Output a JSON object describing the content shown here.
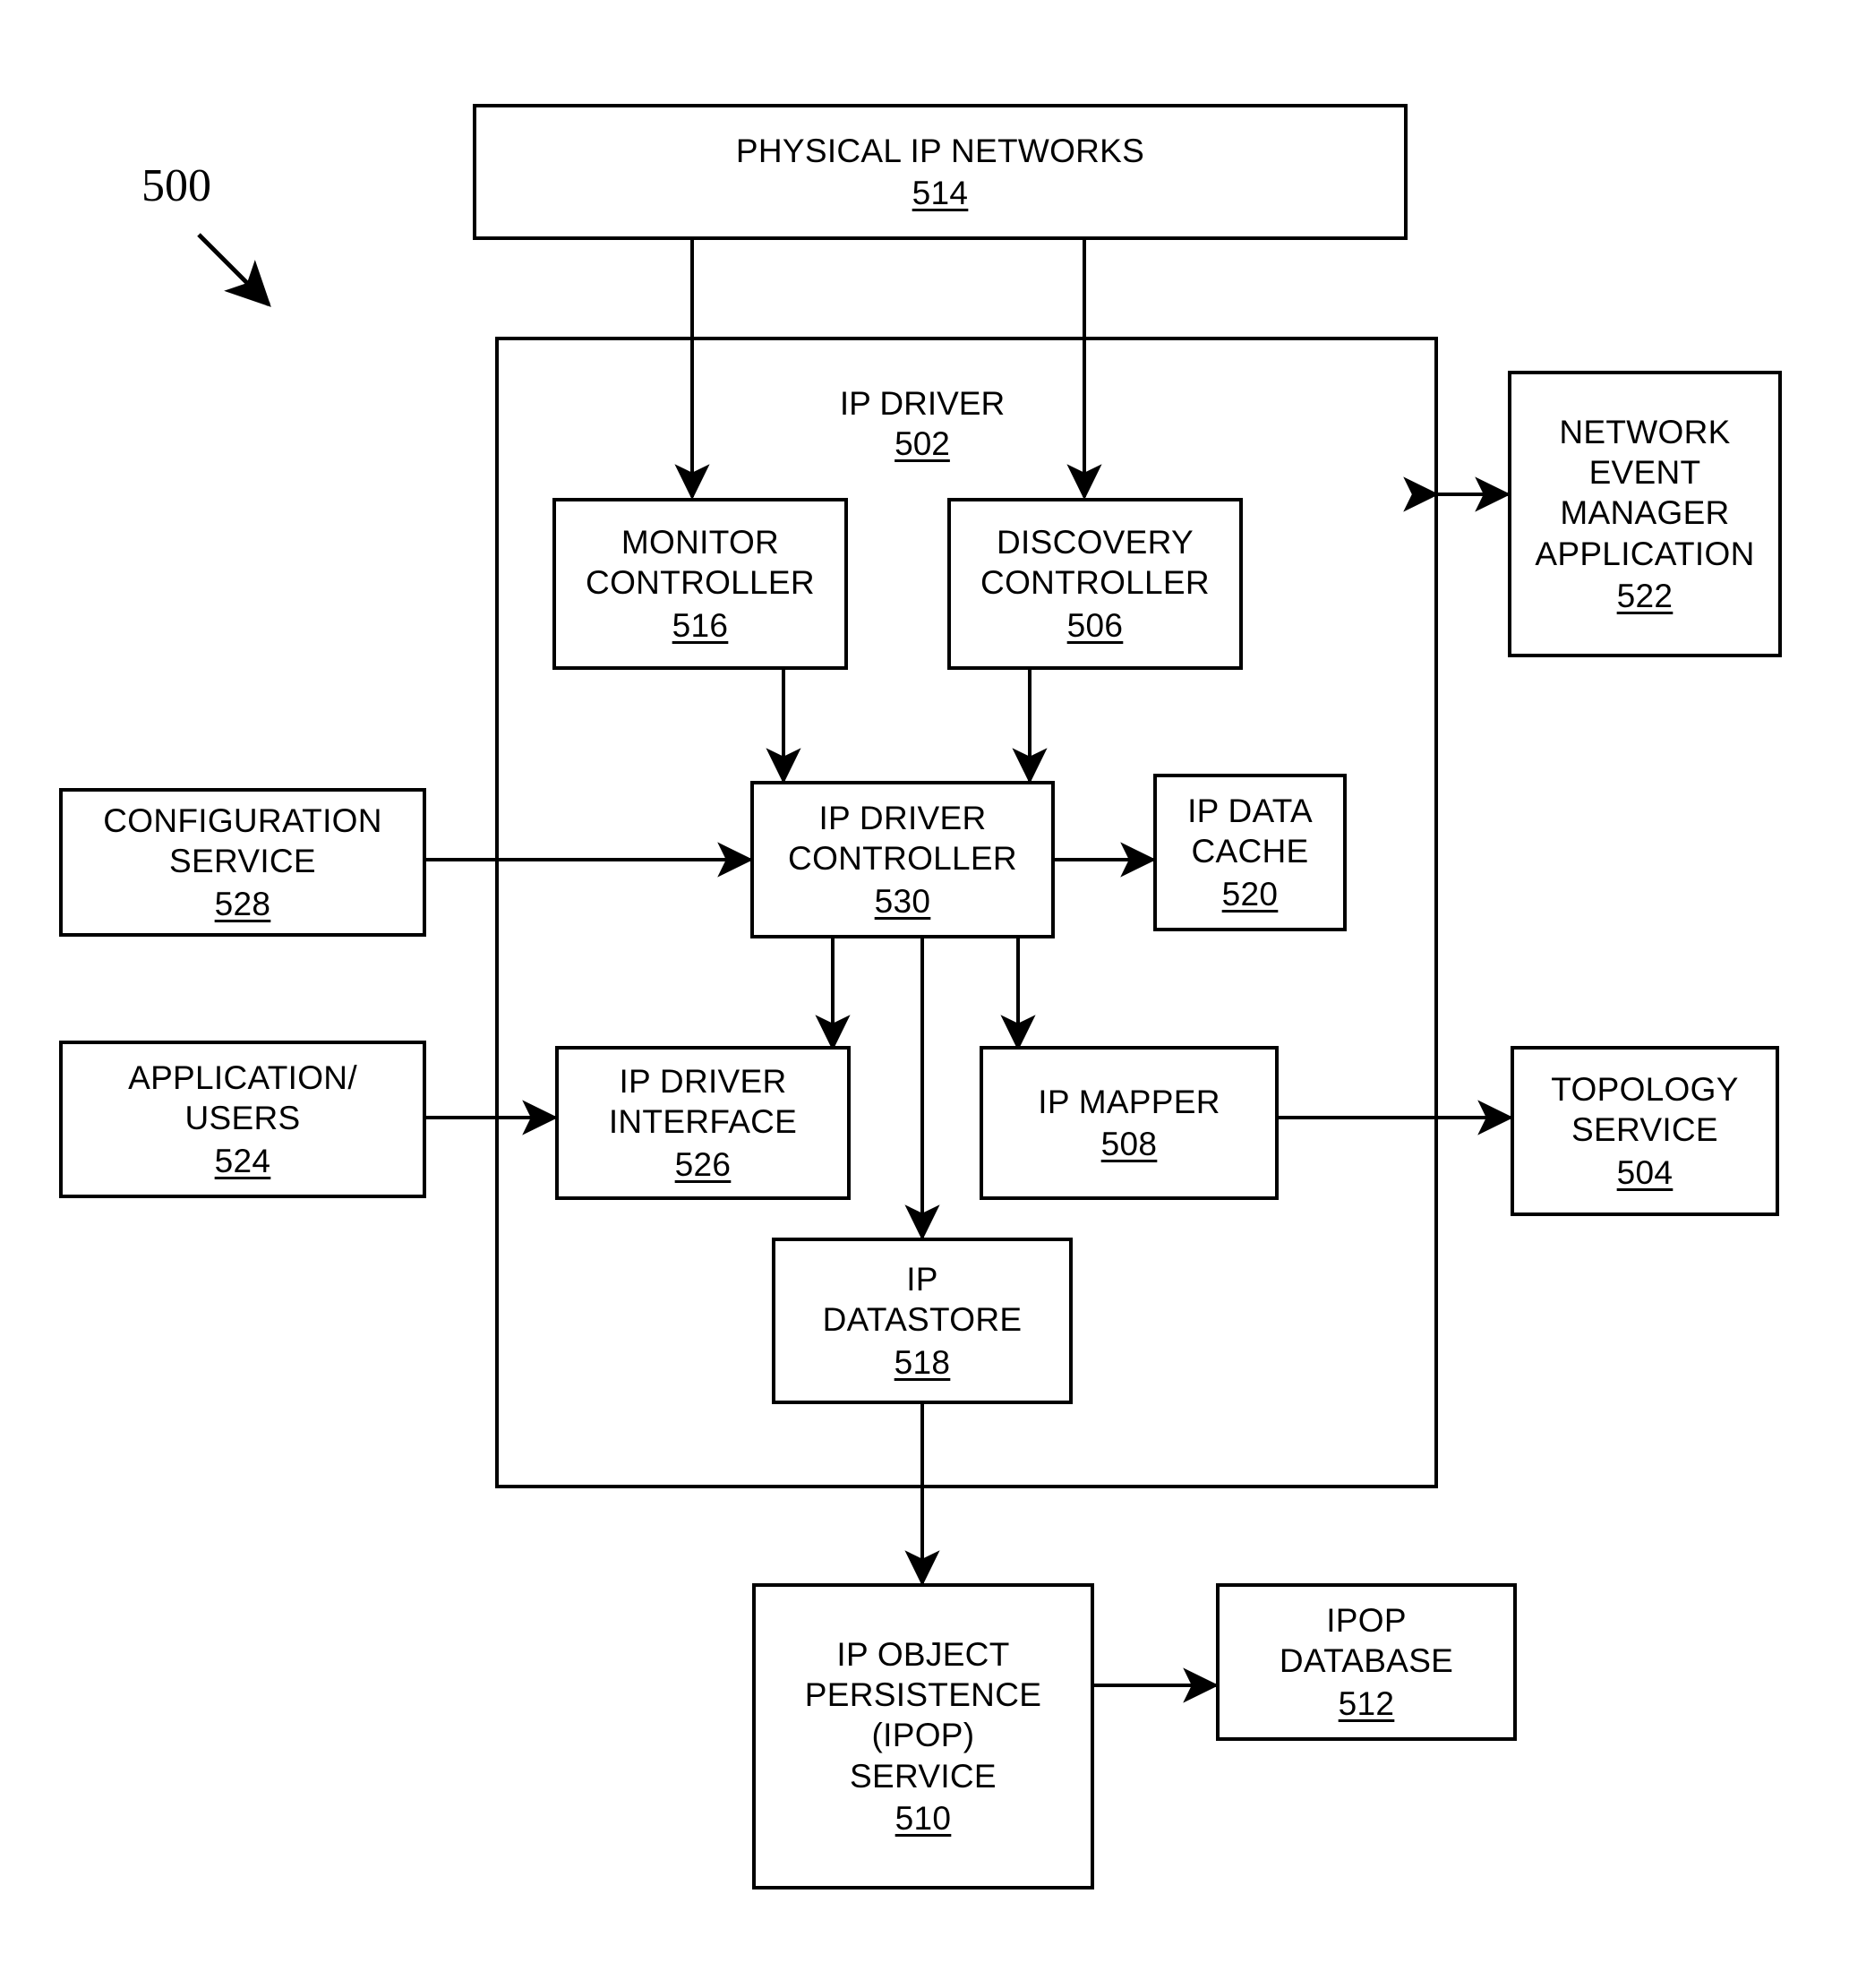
{
  "figure": {
    "number": "500",
    "title": "IP Driver architecture block diagram"
  },
  "nodes": {
    "physical_ip_networks": {
      "label": "PHYSICAL IP NETWORKS",
      "ref": "514"
    },
    "ip_driver": {
      "label": "IP DRIVER",
      "ref": "502"
    },
    "monitor_controller": {
      "label": "MONITOR\nCONTROLLER",
      "ref": "516"
    },
    "discovery_controller": {
      "label": "DISCOVERY\nCONTROLLER",
      "ref": "506"
    },
    "network_event_manager": {
      "label": "NETWORK\nEVENT\nMANAGER\nAPPLICATION",
      "ref": "522"
    },
    "configuration_service": {
      "label": "CONFIGURATION\nSERVICE",
      "ref": "528"
    },
    "ip_driver_controller": {
      "label": "IP DRIVER\nCONTROLLER",
      "ref": "530"
    },
    "ip_data_cache": {
      "label": "IP DATA\nCACHE",
      "ref": "520"
    },
    "application_users": {
      "label": "APPLICATION/\nUSERS",
      "ref": "524"
    },
    "ip_driver_interface": {
      "label": "IP DRIVER\nINTERFACE",
      "ref": "526"
    },
    "ip_mapper": {
      "label": "IP MAPPER",
      "ref": "508"
    },
    "topology_service": {
      "label": "TOPOLOGY\nSERVICE",
      "ref": "504"
    },
    "ip_datastore": {
      "label": "IP\nDATASTORE",
      "ref": "518"
    },
    "ip_object_persistence": {
      "label": "IP OBJECT\nPERSISTENCE\n(IPOP)\nSERVICE",
      "ref": "510"
    },
    "ipop_database": {
      "label": "IPOP\nDATABASE",
      "ref": "512"
    }
  },
  "connections": [
    {
      "name": "networks-to-monitor",
      "from": "physical_ip_networks",
      "to": "monitor_controller",
      "arrows": "both"
    },
    {
      "name": "networks-to-discovery",
      "from": "physical_ip_networks",
      "to": "discovery_controller",
      "arrows": "both"
    },
    {
      "name": "monitor-to-driver-controller",
      "from": "monitor_controller",
      "to": "ip_driver_controller",
      "arrows": "both"
    },
    {
      "name": "discovery-to-driver-controller",
      "from": "discovery_controller",
      "to": "ip_driver_controller",
      "arrows": "both"
    },
    {
      "name": "config-to-driver-controller",
      "from": "configuration_service",
      "to": "ip_driver_controller",
      "arrows": "both"
    },
    {
      "name": "driver-controller-to-cache",
      "from": "ip_driver_controller",
      "to": "ip_data_cache",
      "arrows": "both"
    },
    {
      "name": "driver-controller-to-interface",
      "from": "ip_driver_controller",
      "to": "ip_driver_interface",
      "arrows": "both"
    },
    {
      "name": "driver-controller-to-mapper",
      "from": "ip_driver_controller",
      "to": "ip_mapper",
      "arrows": "both"
    },
    {
      "name": "driver-controller-to-datastore",
      "from": "ip_driver_controller",
      "to": "ip_datastore",
      "arrows": "both"
    },
    {
      "name": "users-to-interface",
      "from": "application_users",
      "to": "ip_driver_interface",
      "arrows": "both"
    },
    {
      "name": "mapper-to-topology",
      "from": "ip_mapper",
      "to": "topology_service",
      "arrows": "both"
    },
    {
      "name": "driver-to-event-manager",
      "from": "ip_driver",
      "to": "network_event_manager",
      "arrows": "both"
    },
    {
      "name": "datastore-to-ipop",
      "from": "ip_datastore",
      "to": "ip_object_persistence",
      "arrows": "both"
    },
    {
      "name": "ipop-to-database",
      "from": "ip_object_persistence",
      "to": "ipop_database",
      "arrows": "both"
    }
  ],
  "colors": {
    "line": "#000000",
    "background": "#ffffff",
    "text": "#000000"
  }
}
